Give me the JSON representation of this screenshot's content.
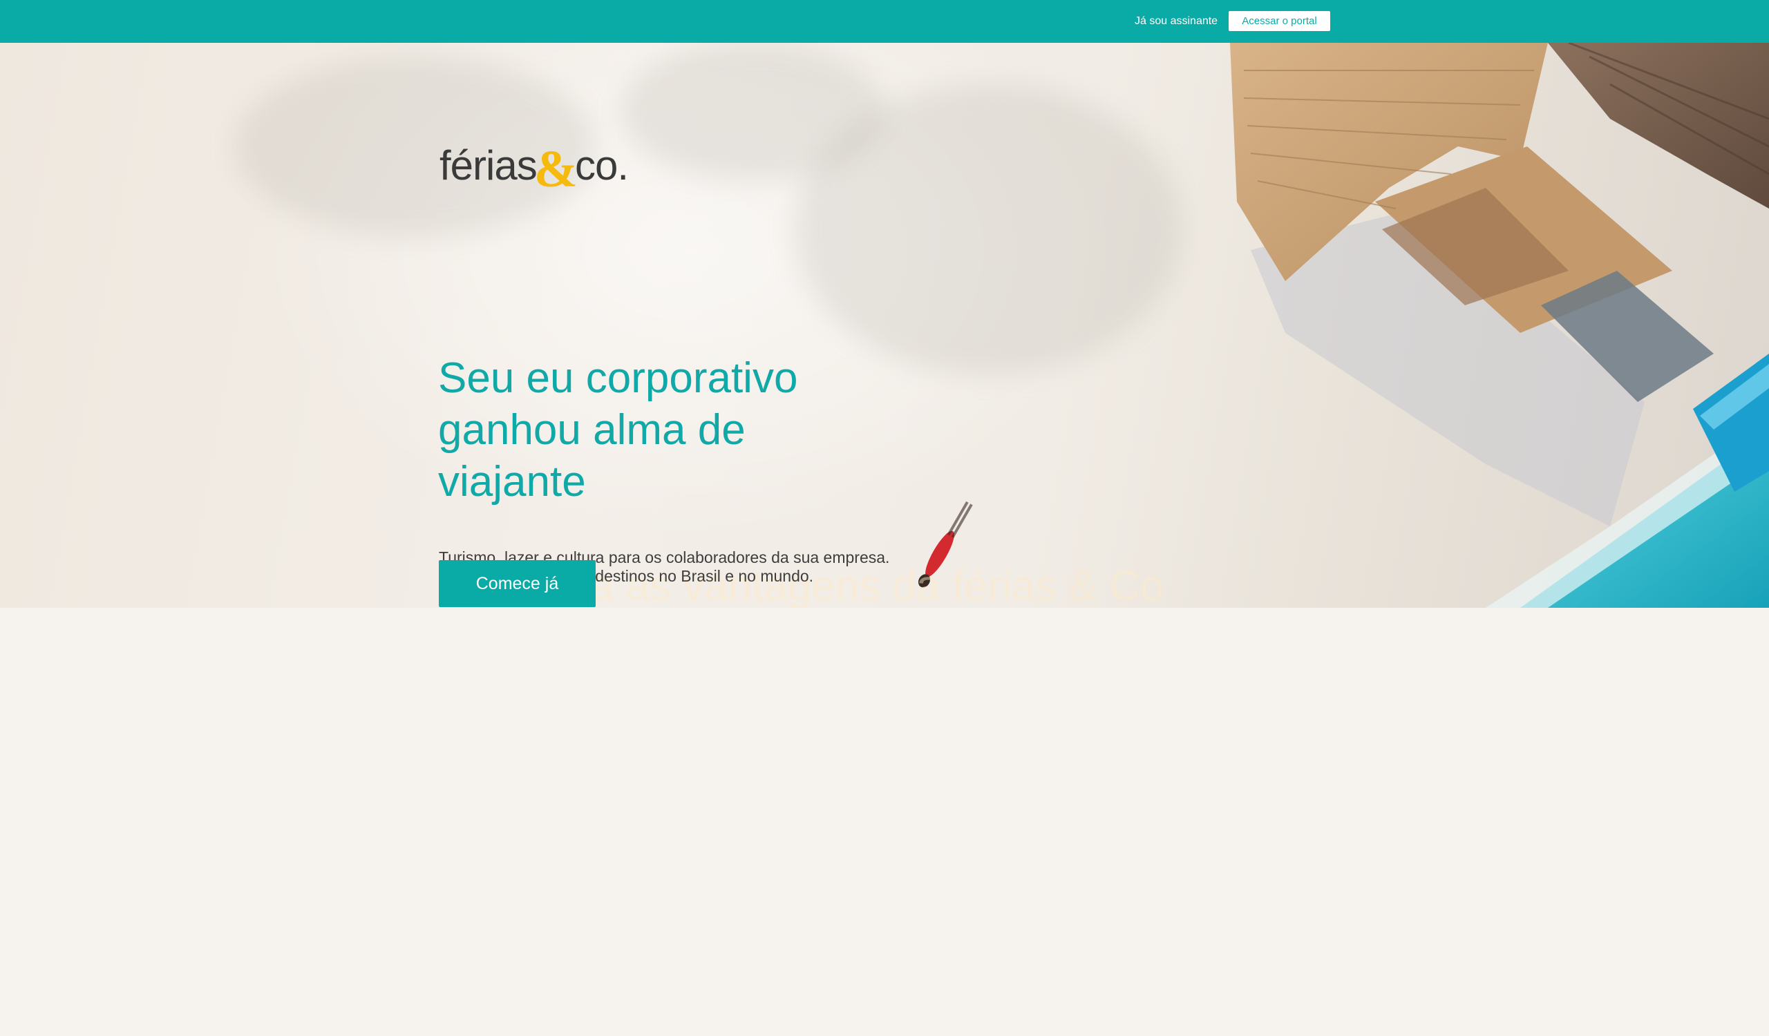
{
  "topbar": {
    "already_subscriber": "Já sou assinante",
    "portal_button": "Acessar o portal"
  },
  "logo": {
    "word": "férias",
    "amp": "&",
    "suffix": "co."
  },
  "hero": {
    "headline": "Seu eu corporativo ganhou alma de viajante",
    "subtitle_line1": "Turismo, lazer e cultura para os colaboradores da sua empresa.",
    "subtitle_line2": "Acesso aos melhores destinos no Brasil e no mundo.",
    "ghost_text": "Conheça as vantagens da férias & Co",
    "cta_label": "Comece já"
  },
  "colors": {
    "accent": "#0aaba7",
    "headline": "#11a9a7",
    "logo_amp": "#f6b90d",
    "page_background": "#f6f2ee"
  }
}
